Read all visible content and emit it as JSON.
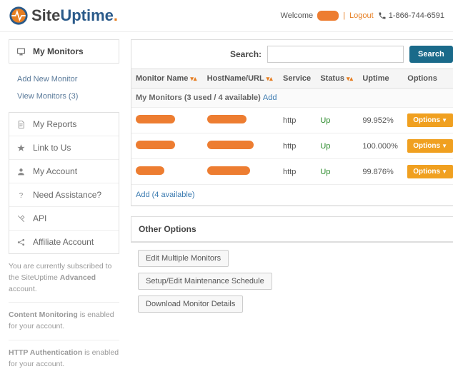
{
  "header": {
    "brand_site": "Site",
    "brand_uptime": "Uptime",
    "brand_dot": ".",
    "welcome": "Welcome",
    "logout": "Logout",
    "phone": "1-866-744-6591"
  },
  "sidebar": {
    "my_monitors": "My Monitors",
    "add_new": "Add New Monitor",
    "view_monitors": "View Monitors (3)",
    "my_reports": "My Reports",
    "link_to_us": "Link to Us",
    "my_account": "My Account",
    "need_assist": "Need Assistance?",
    "api": "API",
    "affiliate": "Affiliate Account",
    "note1_a": "You are currently subscribed to the SiteUptime ",
    "note1_b": "Advanced",
    "note1_c": " account.",
    "note2_a": "Content Monitoring",
    "note2_b": " is enabled for your account.",
    "note3_a": "HTTP Authentication",
    "note3_b": " is enabled for your account."
  },
  "search": {
    "label": "Search:",
    "button": "Search",
    "value": ""
  },
  "table": {
    "cols": {
      "name": "Monitor Name",
      "host": "HostName/URL",
      "service": "Service",
      "status": "Status",
      "uptime": "Uptime",
      "options": "Options"
    },
    "subheader_a": "My Monitors (3 used / 4 available) ",
    "subheader_add": "Add",
    "rows": [
      {
        "service": "http",
        "status": "Up",
        "uptime": "99.952%"
      },
      {
        "service": "http",
        "status": "Up",
        "uptime": "100.000%"
      },
      {
        "service": "http",
        "status": "Up",
        "uptime": "99.876%"
      }
    ],
    "options_btn": "Options",
    "add_link": "Add (4 available)"
  },
  "other": {
    "title": "Other Options",
    "edit_multiple": "Edit Multiple Monitors",
    "maintenance": "Setup/Edit Maintenance Schedule",
    "download": "Download Monitor Details"
  }
}
